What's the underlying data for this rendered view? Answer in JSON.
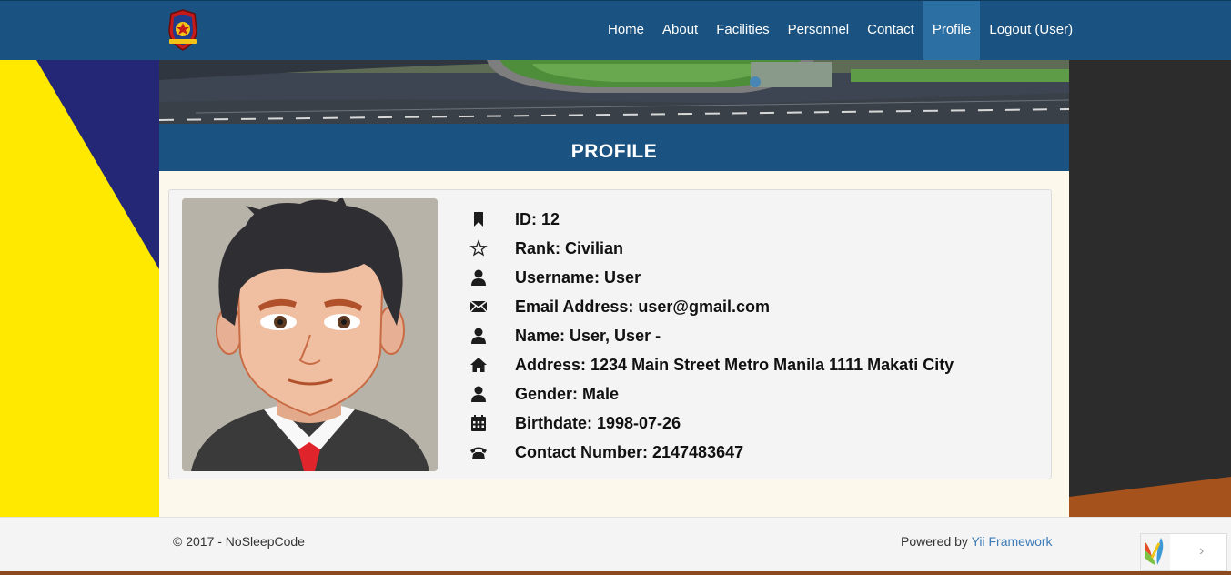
{
  "nav": {
    "items": [
      {
        "label": "Home",
        "active": false
      },
      {
        "label": "About",
        "active": false
      },
      {
        "label": "Facilities",
        "active": false
      },
      {
        "label": "Personnel",
        "active": false
      },
      {
        "label": "Contact",
        "active": false
      },
      {
        "label": "Profile",
        "active": true
      },
      {
        "label": "Logout (User)",
        "active": false
      }
    ]
  },
  "page": {
    "heading": "PROFILE"
  },
  "profile": {
    "fields": [
      {
        "icon": "bookmark-icon",
        "text": "ID: 12"
      },
      {
        "icon": "star-icon",
        "text": "Rank: Civilian"
      },
      {
        "icon": "user-icon",
        "text": "Username: User"
      },
      {
        "icon": "envelope-icon",
        "text": "Email Address: user@gmail.com"
      },
      {
        "icon": "user-icon",
        "text": "Name: User, User -"
      },
      {
        "icon": "home-icon",
        "text": "Address: 1234 Main Street Metro Manila 1111 Makati City"
      },
      {
        "icon": "user-icon",
        "text": "Gender: Male"
      },
      {
        "icon": "calendar-icon",
        "text": "Birthdate: 1998-07-26"
      },
      {
        "icon": "phone-icon",
        "text": "Contact Number: 2147483647"
      }
    ]
  },
  "footer": {
    "copyright": "© 2017 - NoSleepCode",
    "powered_prefix": "Powered by ",
    "powered_link": "Yii Framework",
    "toolbar_arrow": "›"
  },
  "colors": {
    "navbar": "#1a5381",
    "nav_active": "#2c6fa3",
    "content_bg": "#fdf8ec",
    "card_bg": "#f4f4f4",
    "link": "#3e7bb6"
  }
}
